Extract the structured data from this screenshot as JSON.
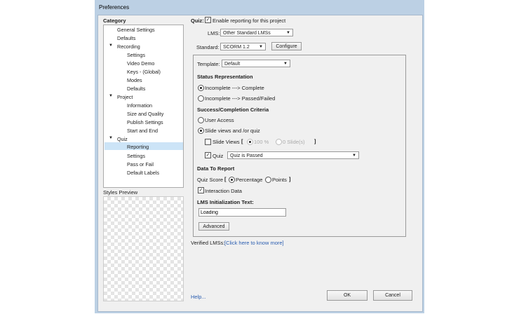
{
  "window": {
    "title": "Preferences"
  },
  "category": {
    "heading": "Category",
    "items": [
      {
        "label": "General Settings"
      },
      {
        "label": "Defaults"
      },
      {
        "label": "Recording"
      },
      {
        "label": "Settings"
      },
      {
        "label": "Video Demo"
      },
      {
        "label": "Keys - (Global)"
      },
      {
        "label": "Modes"
      },
      {
        "label": "Defaults"
      },
      {
        "label": "Project"
      },
      {
        "label": "Information"
      },
      {
        "label": "Size and Quality"
      },
      {
        "label": "Publish Settings"
      },
      {
        "label": "Start and End"
      },
      {
        "label": "Quiz"
      },
      {
        "label": "Reporting"
      },
      {
        "label": "Settings"
      },
      {
        "label": "Pass or Fail"
      },
      {
        "label": "Default Labels"
      }
    ]
  },
  "styles_preview": {
    "label": "Styles Preview"
  },
  "quiz": {
    "label": "Quiz:",
    "enable_label": "Enable reporting for this project"
  },
  "lms": {
    "label": "LMS:",
    "value": "Other Standard LMSs"
  },
  "standard": {
    "label": "Standard:",
    "value": "SCORM 1.2",
    "configure_label": "Configure"
  },
  "template": {
    "label": "Template:",
    "value": "Default"
  },
  "status": {
    "heading": "Status Representation",
    "option1": "Incomplete ---> Complete",
    "option2": "Incomplete ---> Passed/Failed"
  },
  "success": {
    "heading": "Success/Completion Criteria",
    "user_access": "User Access",
    "slide_views_quiz": "Slide views and /or quiz",
    "slide_views_label": "Slide Views",
    "percent_label": "100 %",
    "slides_label": "0 Slide(s)",
    "quiz_label": "Quiz",
    "quiz_value": "Quiz is Passed"
  },
  "report": {
    "heading": "Data To Report",
    "quiz_score_label": "Quiz Score",
    "percentage": "Percentage",
    "points": "Points",
    "interaction_data": "Interaction Data"
  },
  "lms_init": {
    "heading": "LMS Initialization Text:",
    "value": "Loading"
  },
  "advanced_label": "Advanced",
  "verified": {
    "label": "Verified LMSs:",
    "link": "[Click here to know more]"
  },
  "help_label": "Help...",
  "ok_label": "OK",
  "cancel_label": "Cancel",
  "bracket_open": "[",
  "bracket_close": "]",
  "checkmark": "✓"
}
